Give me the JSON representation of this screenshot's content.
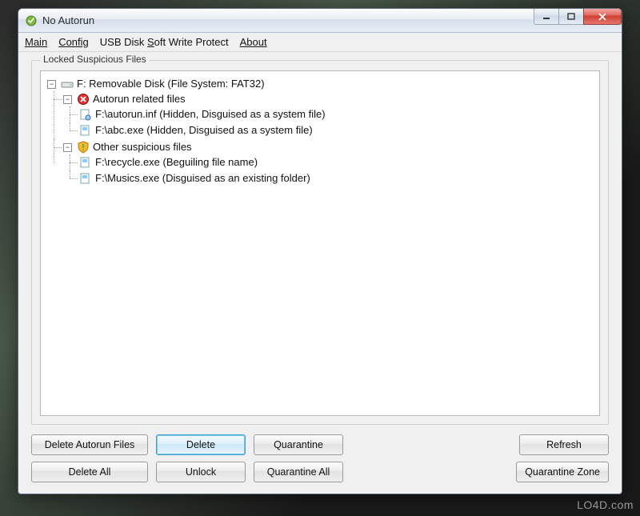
{
  "window": {
    "title": "No Autorun"
  },
  "menu": {
    "main": "Main",
    "config": "Config",
    "usb": "USB Disk Soft Write Protect",
    "about": "About"
  },
  "group": {
    "label": "Locked Suspicious Files"
  },
  "tree": {
    "root": {
      "label": "F: Removable Disk (File System: FAT32)",
      "children": [
        {
          "key": "autorun",
          "label": "Autorun related files",
          "files": [
            "F:\\autorun.inf (Hidden, Disguised as a system file)",
            "F:\\abc.exe (Hidden, Disguised as a system file)"
          ]
        },
        {
          "key": "other",
          "label": "Other suspicious files",
          "files": [
            "F:\\recycle.exe (Beguiling file name)",
            "F:\\Musics.exe (Disguised as an existing folder)"
          ]
        }
      ]
    }
  },
  "buttons": {
    "delete_autorun": "Delete Autorun Files",
    "delete": "Delete",
    "quarantine": "Quarantine",
    "refresh": "Refresh",
    "delete_all": "Delete All",
    "unlock": "Unlock",
    "quarantine_all": "Quarantine All",
    "quarantine_zone": "Quarantine Zone"
  },
  "watermark": "LO4D.com"
}
